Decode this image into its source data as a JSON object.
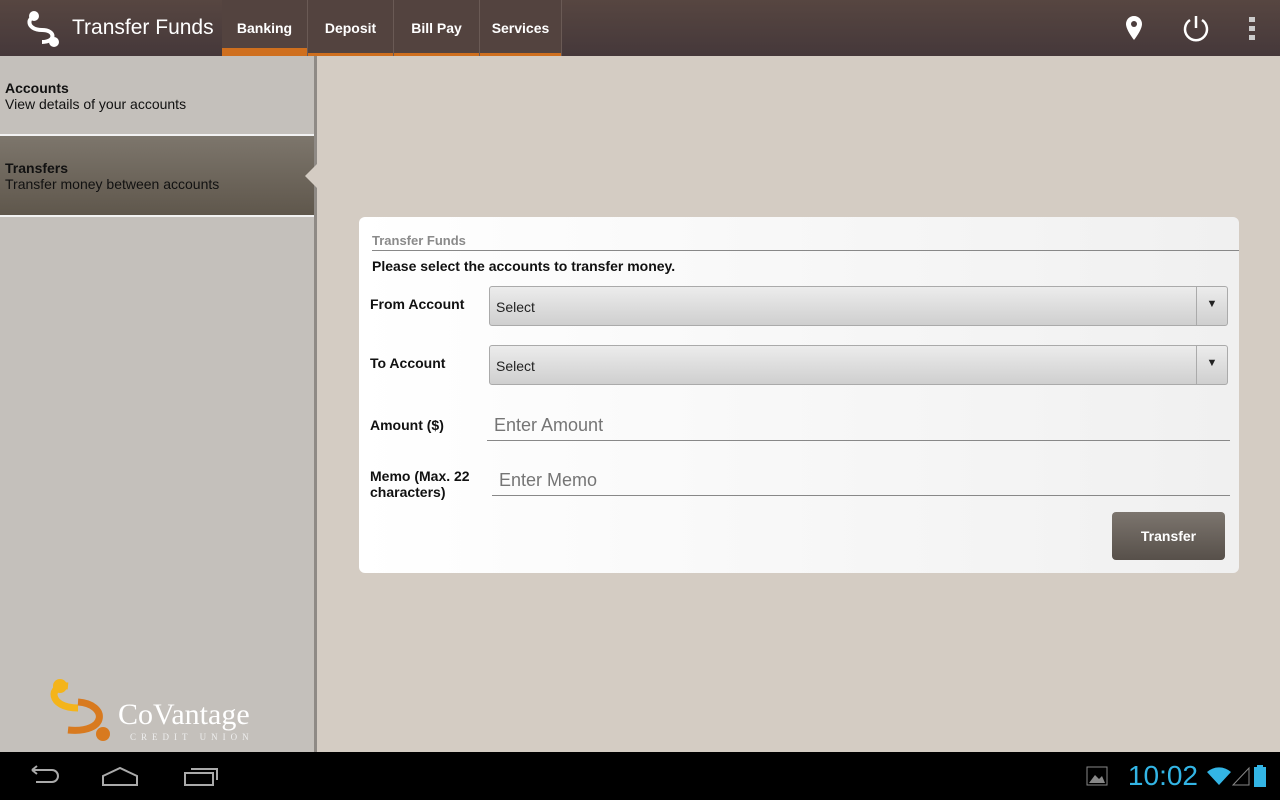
{
  "header": {
    "title": "Transfer Funds",
    "tabs": [
      {
        "label": "Banking"
      },
      {
        "label": "Deposit"
      },
      {
        "label": "Bill Pay"
      },
      {
        "label": "Services"
      }
    ]
  },
  "sidebar": {
    "items": [
      {
        "title": "Accounts",
        "subtitle": "View details of your accounts"
      },
      {
        "title": "Transfers",
        "subtitle": "Transfer money between accounts"
      }
    ],
    "logo": {
      "name": "CoVantage",
      "tagline": "CREDIT UNION"
    }
  },
  "form": {
    "heading": "Transfer Funds",
    "instruction": "Please select the accounts to transfer money.",
    "from_label": "From Account",
    "from_value": "Select",
    "to_label": "To Account",
    "to_value": "Select",
    "amount_label": "Amount ($)",
    "amount_placeholder": "Enter Amount",
    "memo_label": "Memo (Max. 22 characters)",
    "memo_placeholder": "Enter Memo",
    "submit": "Transfer"
  },
  "system": {
    "time": "10:02"
  }
}
